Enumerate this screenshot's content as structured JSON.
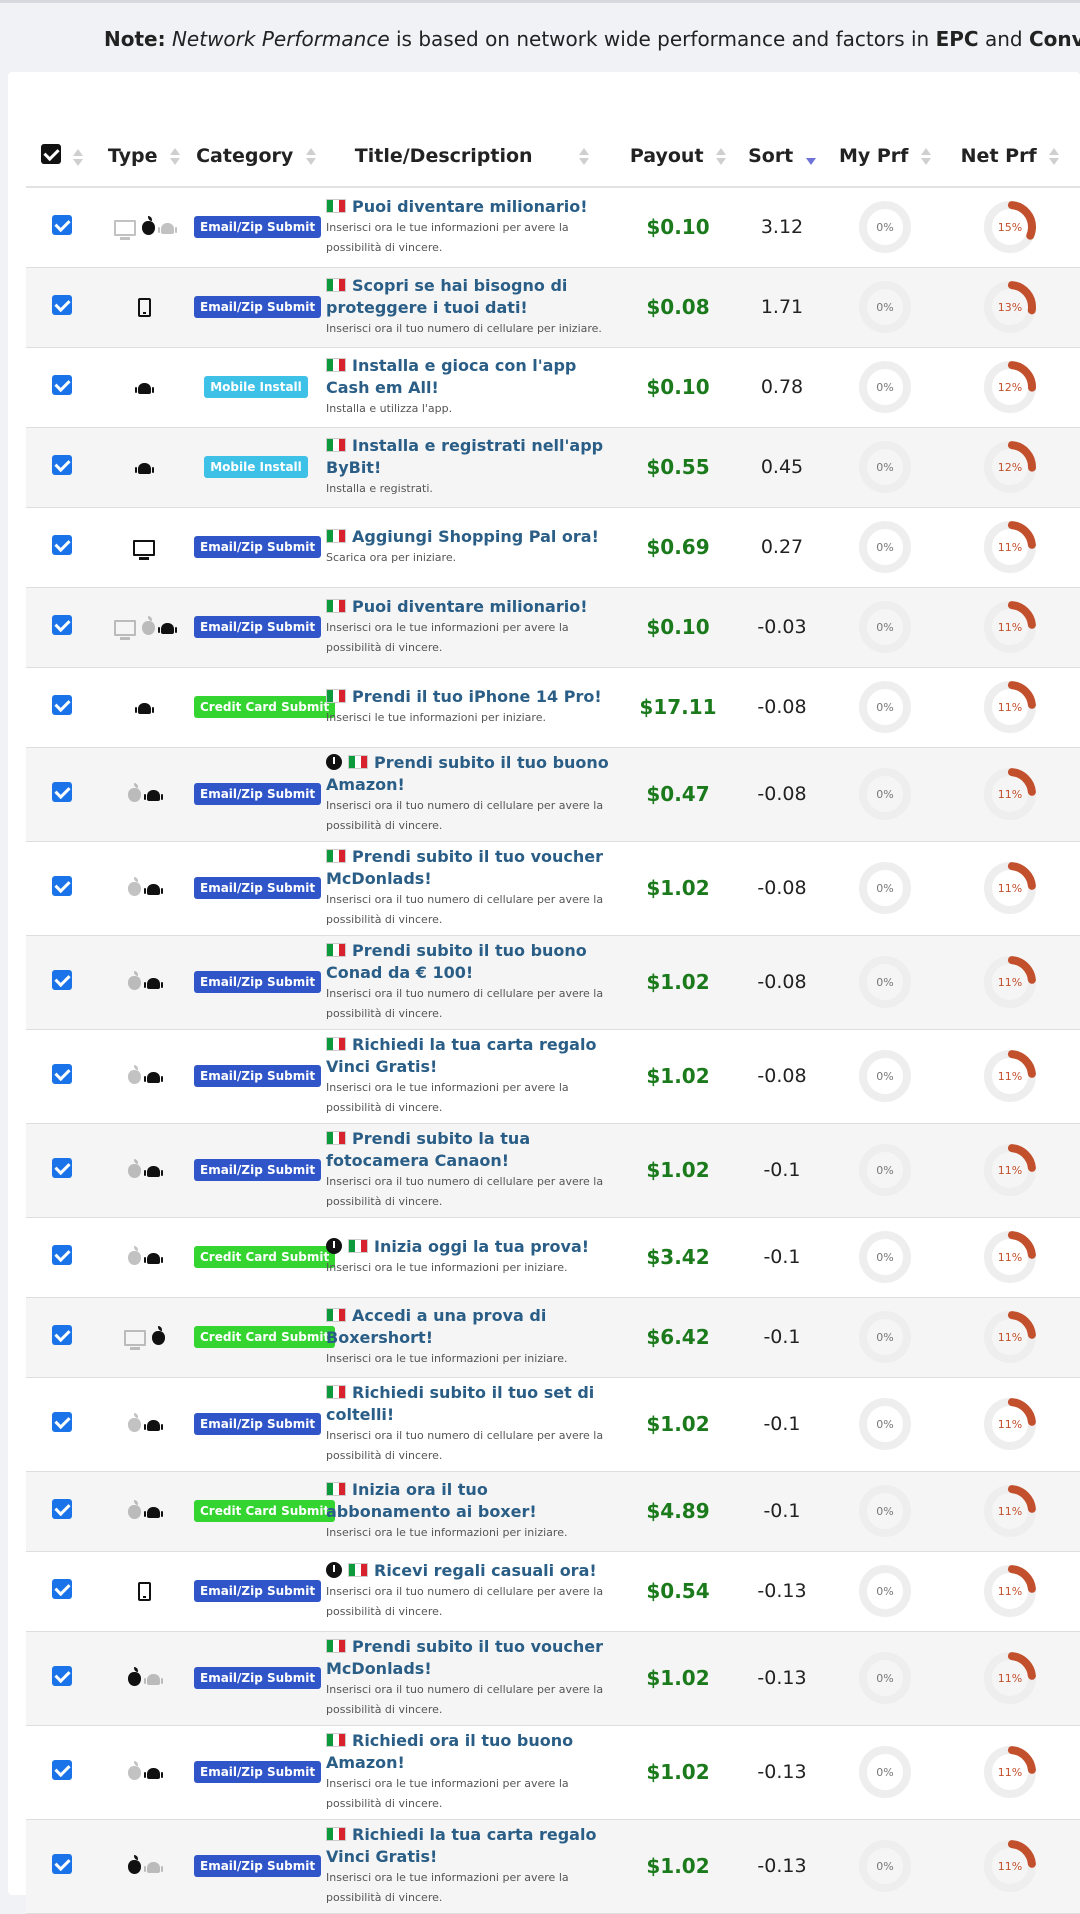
{
  "note": {
    "prefix": "Note:",
    "italic": "Network Performance",
    "text": "is based on network wide performance and factors in",
    "epc": "EPC",
    "and": "and",
    "conv": "Conversion Rat"
  },
  "table": {
    "headers": {
      "type": "Type",
      "category": "Category",
      "title": "Title/Description",
      "payout": "Payout",
      "sort": "Sort",
      "my_prf": "My Prf",
      "net_prf": "Net Prf"
    },
    "rows": [
      {
        "platforms": [
          {
            "icon": "desktop-icon",
            "active": false
          },
          {
            "icon": "apple-icon",
            "active": true
          },
          {
            "icon": "android-icon",
            "active": false
          }
        ],
        "category": "Email/Zip Submit",
        "timer": false,
        "title": "Puoi diventare milionario!",
        "desc": "Inserisci ora le tue informazioni per avere la possibilità di vincere.",
        "payout": "$0.10",
        "sort": "3.12",
        "my_prf": "0%",
        "net_prf": "15%",
        "net_prf_value": 15
      },
      {
        "platforms": [
          {
            "icon": "mobile-icon",
            "active": true
          }
        ],
        "category": "Email/Zip Submit",
        "timer": false,
        "title": "Scopri se hai bisogno di proteggere i tuoi dati!",
        "desc": "Inserisci ora il tuo numero di cellulare per iniziare.",
        "payout": "$0.08",
        "sort": "1.71",
        "my_prf": "0%",
        "net_prf": "13%",
        "net_prf_value": 13
      },
      {
        "platforms": [
          {
            "icon": "android-icon",
            "active": true
          }
        ],
        "category": "Mobile Install",
        "timer": false,
        "title": "Installa e gioca con l'app Cash em All!",
        "desc": "Installa e utilizza l'app.",
        "payout": "$0.10",
        "sort": "0.78",
        "my_prf": "0%",
        "net_prf": "12%",
        "net_prf_value": 12
      },
      {
        "platforms": [
          {
            "icon": "android-icon",
            "active": true
          }
        ],
        "category": "Mobile Install",
        "timer": false,
        "title": "Installa e registrati nell'app ByBit!",
        "desc": "Installa e registrati.",
        "payout": "$0.55",
        "sort": "0.45",
        "my_prf": "0%",
        "net_prf": "12%",
        "net_prf_value": 12
      },
      {
        "platforms": [
          {
            "icon": "desktop-icon",
            "active": true
          }
        ],
        "category": "Email/Zip Submit",
        "timer": false,
        "title": "Aggiungi Shopping Pal ora!",
        "desc": "Scarica ora per iniziare.",
        "payout": "$0.69",
        "sort": "0.27",
        "my_prf": "0%",
        "net_prf": "11%",
        "net_prf_value": 11
      },
      {
        "platforms": [
          {
            "icon": "desktop-icon",
            "active": false
          },
          {
            "icon": "apple-icon",
            "active": false
          },
          {
            "icon": "android-icon",
            "active": true
          }
        ],
        "category": "Email/Zip Submit",
        "timer": false,
        "title": "Puoi diventare milionario!",
        "desc": "Inserisci ora le tue informazioni per avere la possibilità di vincere.",
        "payout": "$0.10",
        "sort": "-0.03",
        "my_prf": "0%",
        "net_prf": "11%",
        "net_prf_value": 11
      },
      {
        "platforms": [
          {
            "icon": "android-icon",
            "active": true
          }
        ],
        "category": "Credit Card Submit",
        "timer": false,
        "title": "Prendi il tuo iPhone 14 Pro!",
        "desc": "Inserisci le tue informazioni per iniziare.",
        "payout": "$17.11",
        "sort": "-0.08",
        "my_prf": "0%",
        "net_prf": "11%",
        "net_prf_value": 11
      },
      {
        "platforms": [
          {
            "icon": "apple-icon",
            "active": false
          },
          {
            "icon": "android-icon",
            "active": true
          }
        ],
        "category": "Email/Zip Submit",
        "timer": true,
        "title": "Prendi subito il tuo buono Amazon!",
        "desc": "Inserisci ora il tuo numero di cellulare per avere la possibilità di vincere.",
        "payout": "$0.47",
        "sort": "-0.08",
        "my_prf": "0%",
        "net_prf": "11%",
        "net_prf_value": 11
      },
      {
        "platforms": [
          {
            "icon": "apple-icon",
            "active": false
          },
          {
            "icon": "android-icon",
            "active": true
          }
        ],
        "category": "Email/Zip Submit",
        "timer": false,
        "title": "Prendi subito il tuo voucher McDonlads!",
        "desc": "Inserisci ora il tuo numero di cellulare per avere la possibilità di vincere.",
        "payout": "$1.02",
        "sort": "-0.08",
        "my_prf": "0%",
        "net_prf": "11%",
        "net_prf_value": 11
      },
      {
        "platforms": [
          {
            "icon": "apple-icon",
            "active": false
          },
          {
            "icon": "android-icon",
            "active": true
          }
        ],
        "category": "Email/Zip Submit",
        "timer": false,
        "title": "Prendi subito il tuo buono Conad da € 100!",
        "desc": "Inserisci ora il tuo numero di cellulare per avere la possibilità di vincere.",
        "payout": "$1.02",
        "sort": "-0.08",
        "my_prf": "0%",
        "net_prf": "11%",
        "net_prf_value": 11
      },
      {
        "platforms": [
          {
            "icon": "apple-icon",
            "active": false
          },
          {
            "icon": "android-icon",
            "active": true
          }
        ],
        "category": "Email/Zip Submit",
        "timer": false,
        "title": "Richiedi la tua carta regalo Vinci Gratis!",
        "desc": "Inserisci ora le tue informazioni per avere la possibilità di vincere.",
        "payout": "$1.02",
        "sort": "-0.08",
        "my_prf": "0%",
        "net_prf": "11%",
        "net_prf_value": 11
      },
      {
        "platforms": [
          {
            "icon": "apple-icon",
            "active": false
          },
          {
            "icon": "android-icon",
            "active": true
          }
        ],
        "category": "Email/Zip Submit",
        "timer": false,
        "title": "Prendi subito la tua fotocamera Canaon!",
        "desc": "Inserisci ora il tuo numero di cellulare per avere la possibilità di vincere.",
        "payout": "$1.02",
        "sort": "-0.1",
        "my_prf": "0%",
        "net_prf": "11%",
        "net_prf_value": 11
      },
      {
        "platforms": [
          {
            "icon": "apple-icon",
            "active": false
          },
          {
            "icon": "android-icon",
            "active": true
          }
        ],
        "category": "Credit Card Submit",
        "timer": true,
        "title": "Inizia oggi la tua prova!",
        "desc": "Inserisci ora le tue informazioni per iniziare.",
        "payout": "$3.42",
        "sort": "-0.1",
        "my_prf": "0%",
        "net_prf": "11%",
        "net_prf_value": 11
      },
      {
        "platforms": [
          {
            "icon": "desktop-icon",
            "active": false
          },
          {
            "icon": "apple-icon",
            "active": true
          }
        ],
        "category": "Credit Card Submit",
        "timer": false,
        "title": "Accedi a una prova di Boxershort!",
        "desc": "Inserisci ora le tue informazioni per iniziare.",
        "payout": "$6.42",
        "sort": "-0.1",
        "my_prf": "0%",
        "net_prf": "11%",
        "net_prf_value": 11
      },
      {
        "platforms": [
          {
            "icon": "apple-icon",
            "active": false
          },
          {
            "icon": "android-icon",
            "active": true
          }
        ],
        "category": "Email/Zip Submit",
        "timer": false,
        "title": "Richiedi subito il tuo set di coltelli!",
        "desc": "Inserisci ora il tuo numero di cellulare per avere la possibilità di vincere.",
        "payout": "$1.02",
        "sort": "-0.1",
        "my_prf": "0%",
        "net_prf": "11%",
        "net_prf_value": 11
      },
      {
        "platforms": [
          {
            "icon": "apple-icon",
            "active": false
          },
          {
            "icon": "android-icon",
            "active": true
          }
        ],
        "category": "Credit Card Submit",
        "timer": false,
        "title": "Inizia ora il tuo abbonamento ai boxer!",
        "desc": "Inserisci ora le tue informazioni per iniziare.",
        "payout": "$4.89",
        "sort": "-0.1",
        "my_prf": "0%",
        "net_prf": "11%",
        "net_prf_value": 11
      },
      {
        "platforms": [
          {
            "icon": "mobile-icon",
            "active": true
          }
        ],
        "category": "Email/Zip Submit",
        "timer": true,
        "title": "Ricevi regali casuali ora!",
        "desc": "Inserisci ora il tuo numero di cellulare per avere la possibilità di vincere.",
        "payout": "$0.54",
        "sort": "-0.13",
        "my_prf": "0%",
        "net_prf": "11%",
        "net_prf_value": 11
      },
      {
        "platforms": [
          {
            "icon": "apple-icon",
            "active": true
          },
          {
            "icon": "android-icon",
            "active": false
          }
        ],
        "category": "Email/Zip Submit",
        "timer": false,
        "title": "Prendi subito il tuo voucher McDonlads!",
        "desc": "Inserisci ora il tuo numero di cellulare per avere la possibilità di vincere.",
        "payout": "$1.02",
        "sort": "-0.13",
        "my_prf": "0%",
        "net_prf": "11%",
        "net_prf_value": 11
      },
      {
        "platforms": [
          {
            "icon": "apple-icon",
            "active": false
          },
          {
            "icon": "android-icon",
            "active": true
          }
        ],
        "category": "Email/Zip Submit",
        "timer": false,
        "title": "Richiedi ora il tuo buono Amazon!",
        "desc": "Inserisci ora le tue informazioni per avere la possibilità di vincere.",
        "payout": "$1.02",
        "sort": "-0.13",
        "my_prf": "0%",
        "net_prf": "11%",
        "net_prf_value": 11
      },
      {
        "platforms": [
          {
            "icon": "apple-icon",
            "active": true
          },
          {
            "icon": "android-icon",
            "active": false
          }
        ],
        "category": "Email/Zip Submit",
        "timer": false,
        "title": "Richiedi la tua carta regalo Vinci Gratis!",
        "desc": "Inserisci ora le tue informazioni per avere la possibilità di vincere.",
        "payout": "$1.02",
        "sort": "-0.13",
        "my_prf": "0%",
        "net_prf": "11%",
        "net_prf_value": 11
      }
    ]
  },
  "colors": {
    "checkbox": "#1a73e8",
    "payout": "#1b7a1b",
    "title_link": "#2a5e86",
    "badge_email": "#2f55c8",
    "badge_mobile": "#3ec1e6",
    "badge_cc": "#34d431",
    "net_prf_arc": "#c2502d",
    "ring_track": "#eeeeee"
  }
}
